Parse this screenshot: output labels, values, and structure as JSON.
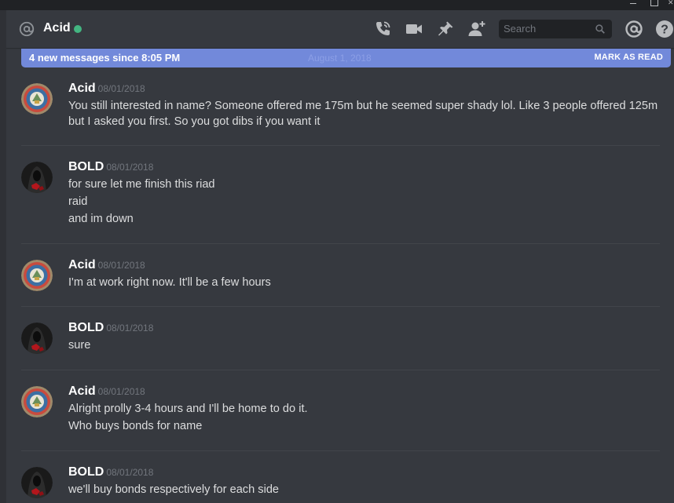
{
  "window": {
    "controls": [
      "minimize",
      "maximize",
      "close"
    ]
  },
  "header": {
    "title": "Acid",
    "status": "online",
    "status_color": "#43b581",
    "icons": [
      "at-icon",
      "call-icon",
      "video-icon",
      "pin-icon",
      "add-friend-icon",
      "mention-icon",
      "help-icon"
    ],
    "search_placeholder": "Search"
  },
  "new_messages_bar": {
    "text": "4 new messages since 8:05 PM",
    "ghost_date": "August 1, 2018",
    "action": "MARK AS READ",
    "color": "#7289da"
  },
  "messages": [
    {
      "author": "Acid",
      "timestamp": "08/01/2018",
      "avatar": "acid-avatar",
      "lines": [
        "You still interested in name? Someone offered me 175m but he seemed super shady lol. Like 3 people offered 125m",
        "but I asked you first. So you got dibs if you want it"
      ]
    },
    {
      "author": "BOLD",
      "timestamp": "08/01/2018",
      "avatar": "bold-avatar",
      "lines": [
        "for sure let me finish this riad",
        "raid",
        "and im down"
      ]
    },
    {
      "author": "Acid",
      "timestamp": "08/01/2018",
      "avatar": "acid-avatar",
      "lines": [
        "I'm at work right now. It'll be a few hours"
      ]
    },
    {
      "author": "BOLD",
      "timestamp": "08/01/2018",
      "avatar": "bold-avatar",
      "lines": [
        "sure"
      ]
    },
    {
      "author": "Acid",
      "timestamp": "08/01/2018",
      "avatar": "acid-avatar",
      "lines": [
        "Alright prolly 3-4 hours and I'll be home to do it.",
        "Who buys bonds for name"
      ]
    },
    {
      "author": "BOLD",
      "timestamp": "08/01/2018",
      "avatar": "bold-avatar",
      "lines": [
        "we'll buy bonds respectively for each side"
      ]
    }
  ]
}
